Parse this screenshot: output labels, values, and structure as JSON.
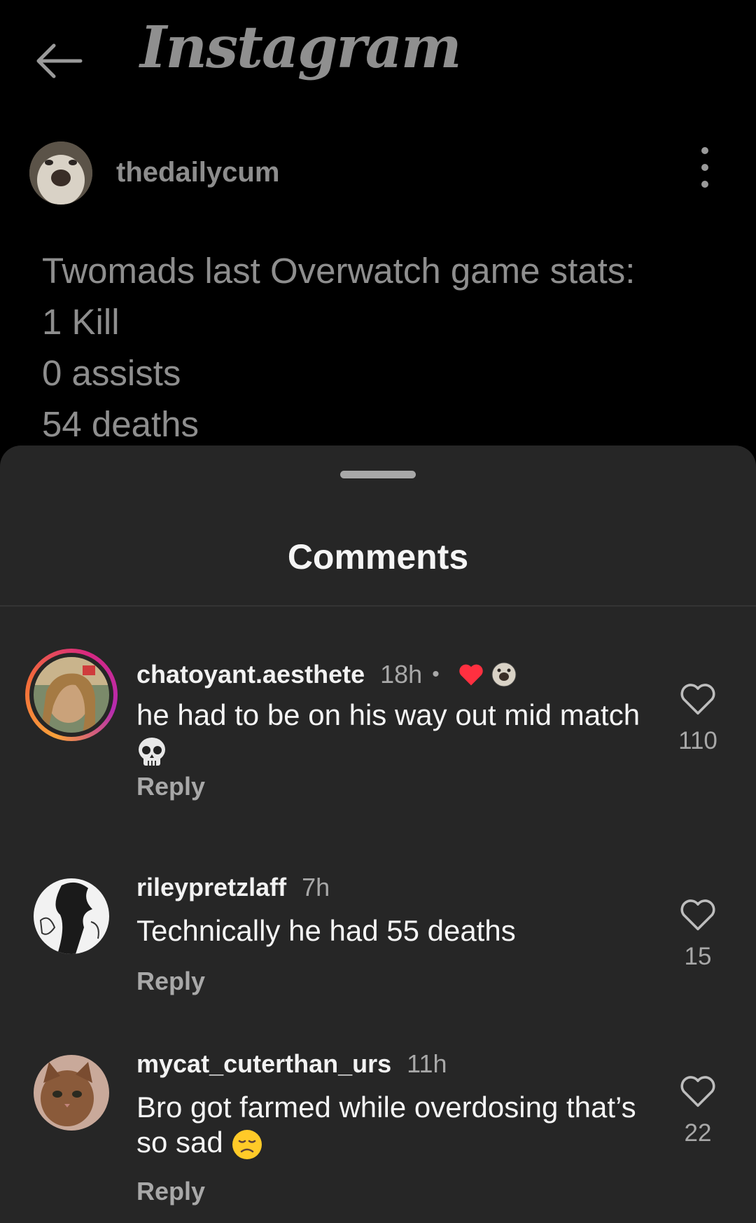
{
  "header": {
    "app_name": "Instagram",
    "back_icon": "arrow-left-icon"
  },
  "post": {
    "username": "thedailycum",
    "more_icon": "more-vertical-icon",
    "caption_lines": [
      "Twomads last Overwatch game stats:",
      "1 Kill",
      "0 assists",
      "54 deaths"
    ]
  },
  "comments_sheet": {
    "title": "Comments",
    "comments": [
      {
        "username": "chatoyant.aesthete",
        "time": "18h",
        "separator": "•",
        "creator_liked": true,
        "text": "he had to be on his way out mid match",
        "trailing_emoji": "skull-emoji",
        "reply_label": "Reply",
        "like_count": "110",
        "has_story_ring": true
      },
      {
        "username": "rileypretzlaff",
        "time": "7h",
        "text": "Technically he had 55 deaths",
        "reply_label": "Reply",
        "like_count": "15"
      },
      {
        "username": "mycat_cuterthan_urs",
        "time": "11h",
        "text": "Bro got farmed while overdosing that’s so sad",
        "trailing_emoji": "disappointed-face-emoji",
        "reply_label": "Reply",
        "like_count": "22"
      }
    ]
  },
  "colors": {
    "background": "#000000",
    "sheet": "#262626",
    "secondary_text": "#a8a8a8",
    "heart_red": "#ff3040"
  }
}
